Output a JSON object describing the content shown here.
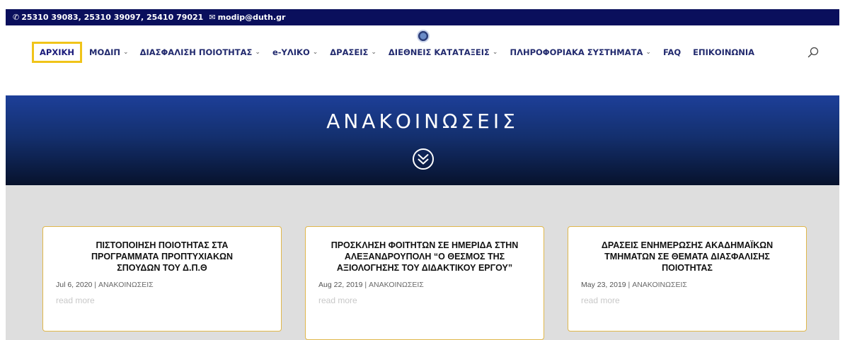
{
  "topbar": {
    "phones": "25310 39083, 25310 39097, 25410 79021",
    "email": "modip@duth.gr"
  },
  "nav": {
    "items": [
      {
        "label": "ΑΡΧΙΚΗ",
        "dropdown": false,
        "active": true
      },
      {
        "label": "ΜΟΔΙΠ",
        "dropdown": true
      },
      {
        "label": "ΔΙΑΣΦΑΛΙΣΗ ΠΟΙΟΤΗΤΑΣ",
        "dropdown": true
      },
      {
        "label": "e-ΥΛΙΚΟ",
        "dropdown": true
      },
      {
        "label": "ΔΡΑΣΕΙΣ",
        "dropdown": true
      },
      {
        "label": "ΔΙΕΘΝΕΙΣ ΚΑΤΑΤΑΞΕΙΣ",
        "dropdown": true
      },
      {
        "label": "ΠΛΗΡΟΦΟΡΙΑΚΑ ΣΥΣΤΗΜΑΤΑ",
        "dropdown": true
      },
      {
        "label": "FAQ",
        "dropdown": false
      },
      {
        "label": "ΕΠΙΚΟΙΝΩΝΙΑ",
        "dropdown": false
      }
    ],
    "chevron": "⌄",
    "active_highlight_color": "#f0c419"
  },
  "hero": {
    "title": "ΑΝΑΚΟΙΝΩΣΕΙΣ",
    "icon": "double-chevron-down-circle-icon"
  },
  "posts": [
    {
      "title": "ΠΙΣΤΟΠΟΙΗΣΗ ΠΟΙΟΤΗΤΑΣ ΣΤΑ ΠΡΟΓΡΑΜΜΑΤΑ ΠΡΟΠΤΥΧΙΑΚΩΝ ΣΠΟΥΔΩΝ ΤΟΥ Δ.Π.Θ",
      "date": "Jul 6, 2020",
      "separator": " | ",
      "category": "ΑΝΑΚΟΙΝΩΣΕΙΣ",
      "read_more": "read more"
    },
    {
      "title": "ΠΡΟΣΚΛΗΣΗ ΦΟΙΤΗΤΩΝ ΣΕ ΗΜΕΡΙΔΑ ΣΤΗΝ ΑΛΕΞΑΝΔΡΟΥΠΟΛΗ “Ο ΘΕΣΜΟΣ ΤΗΣ ΑΞΙΟΛΟΓΗΣΗΣ ΤΟΥ ΔΙΔΑΚΤΙΚΟΥ ΕΡΓΟΥ”",
      "date": "Aug 22, 2019",
      "separator": " | ",
      "category": "ΑΝΑΚΟΙΝΩΣΕΙΣ",
      "read_more": "read more"
    },
    {
      "title": "ΔΡΑΣΕΙΣ ΕΝΗΜΕΡΩΣΗΣ ΑΚΑΔΗΜΑΪΚΩΝ ΤΜΗΜΑΤΩΝ ΣΕ ΘΕΜΑΤΑ ΔΙΑΣΦΑΛΙΣΗΣ ΠΟΙΟΤΗΤΑΣ",
      "date": "May 23, 2019",
      "separator": " | ",
      "category": "ΑΝΑΚΟΙΝΩΣΕΙΣ",
      "read_more": "read more"
    }
  ],
  "colors": {
    "topbar_bg": "#0a0f5c",
    "card_border": "#e0b74b",
    "content_bg": "#dedede"
  }
}
